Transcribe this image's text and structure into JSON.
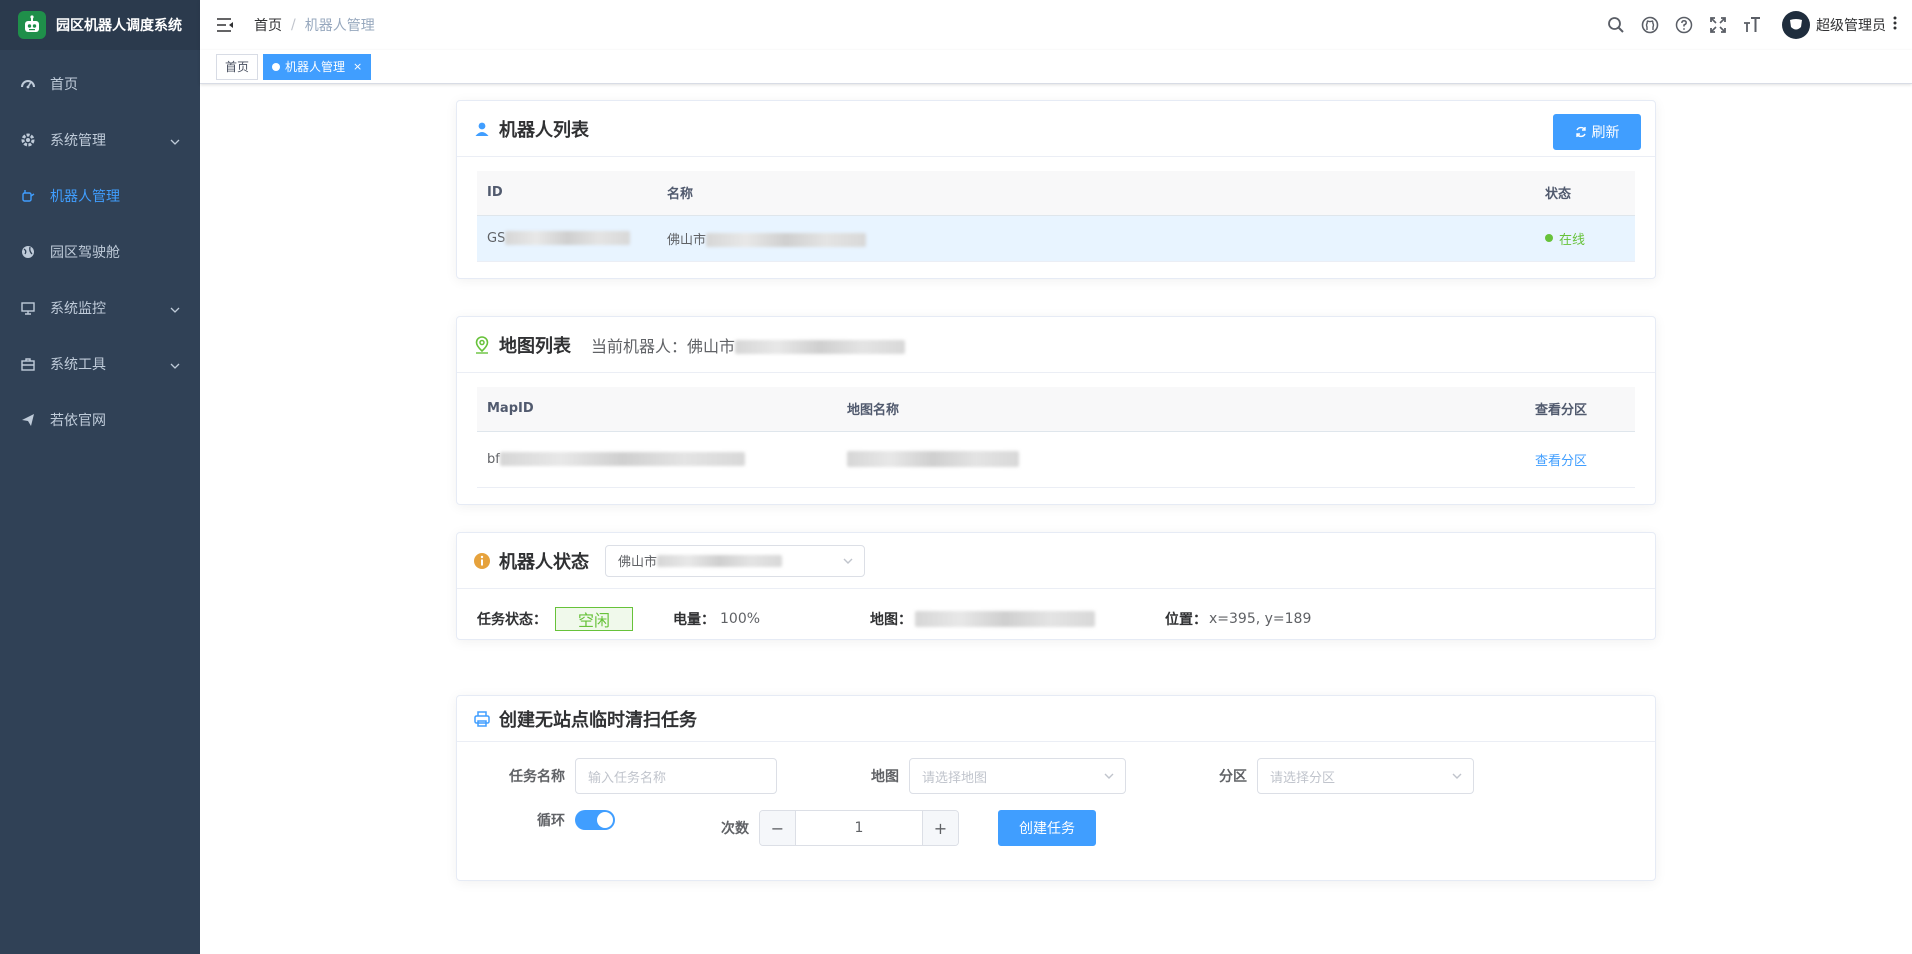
{
  "app": {
    "title": "园区机器人调度系统"
  },
  "sidebar": {
    "items": [
      {
        "label": "首页",
        "icon": "dashboard-icon",
        "has_children": false,
        "active": false
      },
      {
        "label": "系统管理",
        "icon": "gear-icon",
        "has_children": true,
        "active": false
      },
      {
        "label": "机器人管理",
        "icon": "robot-icon",
        "has_children": false,
        "active": true
      },
      {
        "label": "园区驾驶舱",
        "icon": "globe-icon",
        "has_children": false,
        "active": false
      },
      {
        "label": "系统监控",
        "icon": "monitor-icon",
        "has_children": true,
        "active": false
      },
      {
        "label": "系统工具",
        "icon": "toolbox-icon",
        "has_children": true,
        "active": false
      },
      {
        "label": "若依官网",
        "icon": "send-icon",
        "has_children": false,
        "active": false
      }
    ]
  },
  "breadcrumb": {
    "home": "首页",
    "separator": "/",
    "current": "机器人管理"
  },
  "navbar": {
    "user_name": "超级管理员"
  },
  "tags": [
    {
      "label": "首页",
      "active": false
    },
    {
      "label": "机器人管理",
      "active": true,
      "close": "×"
    }
  ],
  "robot_list": {
    "title": "机器人列表",
    "refresh_label": "刷新",
    "columns": [
      "ID",
      "名称",
      "状态"
    ],
    "rows": [
      {
        "id_prefix": "GS",
        "name_prefix": "佛山市",
        "status": "在线"
      }
    ]
  },
  "map_list": {
    "title": "地图列表",
    "current_robot_label": "当前机器人：佛山市",
    "columns": [
      "MapID",
      "地图名称",
      "查看分区"
    ],
    "rows": [
      {
        "mapid_prefix": "bf",
        "map_name": "",
        "action": "查看分区"
      }
    ]
  },
  "robot_status": {
    "title": "机器人状态",
    "select_value": "佛山市",
    "task_label": "任务状态：",
    "task_value": "空闲",
    "battery_label": "电量：",
    "battery_value": "100%",
    "map_label": "地图：",
    "position_label": "位置：",
    "position_value": "x=395, y=189"
  },
  "task_form": {
    "title": "创建无站点临时清扫任务",
    "task_name_label": "任务名称",
    "task_name_placeholder": "输入任务名称",
    "map_label": "地图",
    "map_placeholder": "请选择地图",
    "zone_label": "分区",
    "zone_placeholder": "请选择分区",
    "loop_label": "循环",
    "loop_on": true,
    "count_label": "次数",
    "count_value": "1",
    "minus": "−",
    "plus": "+",
    "submit_label": "创建任务"
  },
  "colors": {
    "sidebar_bg": "#304156",
    "primary": "#409eff",
    "success": "#67c23a"
  }
}
